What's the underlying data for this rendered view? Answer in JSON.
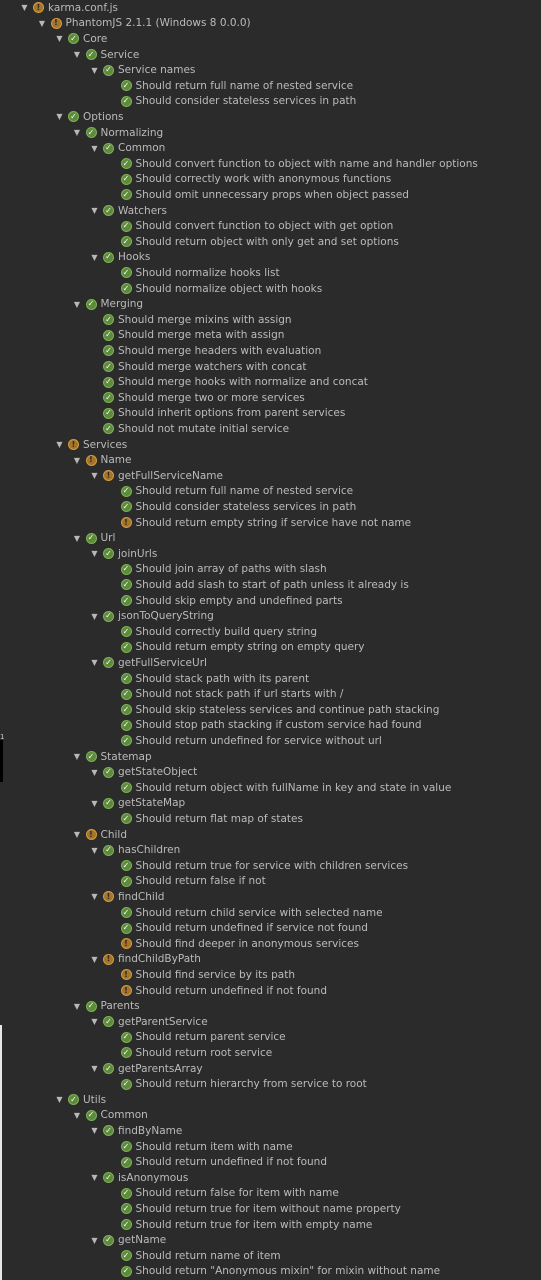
{
  "colors": {
    "background": "#2b2b2b",
    "text": "#bbbbbb",
    "pass": "#5d8a3c",
    "warn": "#d29c43"
  },
  "icons": {
    "pass": "check-circle-icon",
    "warn": "exclamation-circle-icon",
    "expand": "chevron-down-icon"
  },
  "gutter": {
    "line_number": "1"
  },
  "tree": [
    {
      "label": "karma.conf.js",
      "status": "warn",
      "depth": 0,
      "expanded": true
    },
    {
      "label": "PhantomJS 2.1.1 (Windows 8 0.0.0)",
      "status": "warn",
      "depth": 1,
      "expanded": true
    },
    {
      "label": "Core",
      "status": "pass",
      "depth": 2,
      "expanded": true
    },
    {
      "label": "Service",
      "status": "pass",
      "depth": 3,
      "expanded": true
    },
    {
      "label": "Service names",
      "status": "pass",
      "depth": 4,
      "expanded": true
    },
    {
      "label": "Should return full name of nested service",
      "status": "pass",
      "depth": 5
    },
    {
      "label": "Should consider stateless services in path",
      "status": "pass",
      "depth": 5
    },
    {
      "label": "Options",
      "status": "pass",
      "depth": 2,
      "expanded": true
    },
    {
      "label": "Normalizing",
      "status": "pass",
      "depth": 3,
      "expanded": true
    },
    {
      "label": "Common",
      "status": "pass",
      "depth": 4,
      "expanded": true
    },
    {
      "label": "Should convert function to object with name and handler options",
      "status": "pass",
      "depth": 5
    },
    {
      "label": "Should correctly work with anonymous functions",
      "status": "pass",
      "depth": 5
    },
    {
      "label": "Should omit unnecessary props when object passed",
      "status": "pass",
      "depth": 5
    },
    {
      "label": "Watchers",
      "status": "pass",
      "depth": 4,
      "expanded": true
    },
    {
      "label": "Should convert function to object with get option",
      "status": "pass",
      "depth": 5
    },
    {
      "label": "Should return object with only get and set options",
      "status": "pass",
      "depth": 5
    },
    {
      "label": "Hooks",
      "status": "pass",
      "depth": 4,
      "expanded": true
    },
    {
      "label": "Should normalize hooks list",
      "status": "pass",
      "depth": 5
    },
    {
      "label": "Should normalize object with hooks",
      "status": "pass",
      "depth": 5
    },
    {
      "label": "Merging",
      "status": "pass",
      "depth": 3,
      "expanded": true
    },
    {
      "label": "Should merge mixins with assign",
      "status": "pass",
      "depth": 4
    },
    {
      "label": "Should merge meta with assign",
      "status": "pass",
      "depth": 4
    },
    {
      "label": "Should merge headers with evaluation",
      "status": "pass",
      "depth": 4
    },
    {
      "label": "Should merge watchers with concat",
      "status": "pass",
      "depth": 4
    },
    {
      "label": "Should merge hooks with normalize and concat",
      "status": "pass",
      "depth": 4
    },
    {
      "label": "Should merge two or more services",
      "status": "pass",
      "depth": 4
    },
    {
      "label": "Should inherit options from parent services",
      "status": "pass",
      "depth": 4
    },
    {
      "label": "Should not mutate initial service",
      "status": "pass",
      "depth": 4
    },
    {
      "label": "Services",
      "status": "warn",
      "depth": 2,
      "expanded": true
    },
    {
      "label": "Name",
      "status": "warn",
      "depth": 3,
      "expanded": true
    },
    {
      "label": "getFullServiceName",
      "status": "warn",
      "depth": 4,
      "expanded": true
    },
    {
      "label": "Should return full name of nested service",
      "status": "pass",
      "depth": 5
    },
    {
      "label": "Should consider stateless services in path",
      "status": "pass",
      "depth": 5
    },
    {
      "label": "Should return empty string if service have not name",
      "status": "warn",
      "depth": 5
    },
    {
      "label": "Url",
      "status": "pass",
      "depth": 3,
      "expanded": true
    },
    {
      "label": "joinUrls",
      "status": "pass",
      "depth": 4,
      "expanded": true
    },
    {
      "label": "Should join array of paths with slash",
      "status": "pass",
      "depth": 5
    },
    {
      "label": "Should add slash to start of path unless it already is",
      "status": "pass",
      "depth": 5
    },
    {
      "label": "Should skip empty and undefined parts",
      "status": "pass",
      "depth": 5
    },
    {
      "label": "jsonToQueryString",
      "status": "pass",
      "depth": 4,
      "expanded": true
    },
    {
      "label": "Should correctly build query string",
      "status": "pass",
      "depth": 5
    },
    {
      "label": "Should return empty string on empty query",
      "status": "pass",
      "depth": 5
    },
    {
      "label": "getFullServiceUrl",
      "status": "pass",
      "depth": 4,
      "expanded": true
    },
    {
      "label": "Should stack path with its parent",
      "status": "pass",
      "depth": 5
    },
    {
      "label": "Should not stack path if url starts with /",
      "status": "pass",
      "depth": 5
    },
    {
      "label": "Should skip stateless services and continue path stacking",
      "status": "pass",
      "depth": 5
    },
    {
      "label": "Should stop path stacking if custom service had found",
      "status": "pass",
      "depth": 5
    },
    {
      "label": "Should return undefined for service without url",
      "status": "pass",
      "depth": 5
    },
    {
      "label": "Statemap",
      "status": "pass",
      "depth": 3,
      "expanded": true
    },
    {
      "label": "getStateObject",
      "status": "pass",
      "depth": 4,
      "expanded": true
    },
    {
      "label": "Should return object with fullName in key and state in value",
      "status": "pass",
      "depth": 5
    },
    {
      "label": "getStateMap",
      "status": "pass",
      "depth": 4,
      "expanded": true
    },
    {
      "label": "Should return flat map of states",
      "status": "pass",
      "depth": 5
    },
    {
      "label": "Child",
      "status": "warn",
      "depth": 3,
      "expanded": true
    },
    {
      "label": "hasChildren",
      "status": "pass",
      "depth": 4,
      "expanded": true
    },
    {
      "label": "Should return true for service with children services",
      "status": "pass",
      "depth": 5
    },
    {
      "label": "Should return false if not",
      "status": "pass",
      "depth": 5
    },
    {
      "label": "findChild",
      "status": "warn",
      "depth": 4,
      "expanded": true
    },
    {
      "label": "Should return child service with selected name",
      "status": "pass",
      "depth": 5
    },
    {
      "label": "Should return undefined if service not found",
      "status": "pass",
      "depth": 5
    },
    {
      "label": "Should find deeper in anonymous services",
      "status": "warn",
      "depth": 5
    },
    {
      "label": "findChildByPath",
      "status": "warn",
      "depth": 4,
      "expanded": true
    },
    {
      "label": "Should find service by its path",
      "status": "warn",
      "depth": 5
    },
    {
      "label": "Should return undefined if not found",
      "status": "warn",
      "depth": 5
    },
    {
      "label": "Parents",
      "status": "pass",
      "depth": 3,
      "expanded": true
    },
    {
      "label": "getParentService",
      "status": "pass",
      "depth": 4,
      "expanded": true
    },
    {
      "label": "Should return parent service",
      "status": "pass",
      "depth": 5
    },
    {
      "label": "Should return root service",
      "status": "pass",
      "depth": 5
    },
    {
      "label": "getParentsArray",
      "status": "pass",
      "depth": 4,
      "expanded": true
    },
    {
      "label": "Should return hierarchy from service to root",
      "status": "pass",
      "depth": 5
    },
    {
      "label": "Utils",
      "status": "pass",
      "depth": 2,
      "expanded": true
    },
    {
      "label": "Common",
      "status": "pass",
      "depth": 3,
      "expanded": true
    },
    {
      "label": "findByName",
      "status": "pass",
      "depth": 4,
      "expanded": true
    },
    {
      "label": "Should return item with name",
      "status": "pass",
      "depth": 5
    },
    {
      "label": "Should return undefined if not found",
      "status": "pass",
      "depth": 5
    },
    {
      "label": "isAnonymous",
      "status": "pass",
      "depth": 4,
      "expanded": true
    },
    {
      "label": "Should return false for item with name",
      "status": "pass",
      "depth": 5
    },
    {
      "label": "Should return true for item without name property",
      "status": "pass",
      "depth": 5
    },
    {
      "label": "Should return true for item with empty name",
      "status": "pass",
      "depth": 5
    },
    {
      "label": "getName",
      "status": "pass",
      "depth": 4,
      "expanded": true
    },
    {
      "label": "Should return name of item",
      "status": "pass",
      "depth": 5
    },
    {
      "label": "Should return \"Anonymous mixin\" for mixin without name",
      "status": "pass",
      "depth": 5
    }
  ]
}
